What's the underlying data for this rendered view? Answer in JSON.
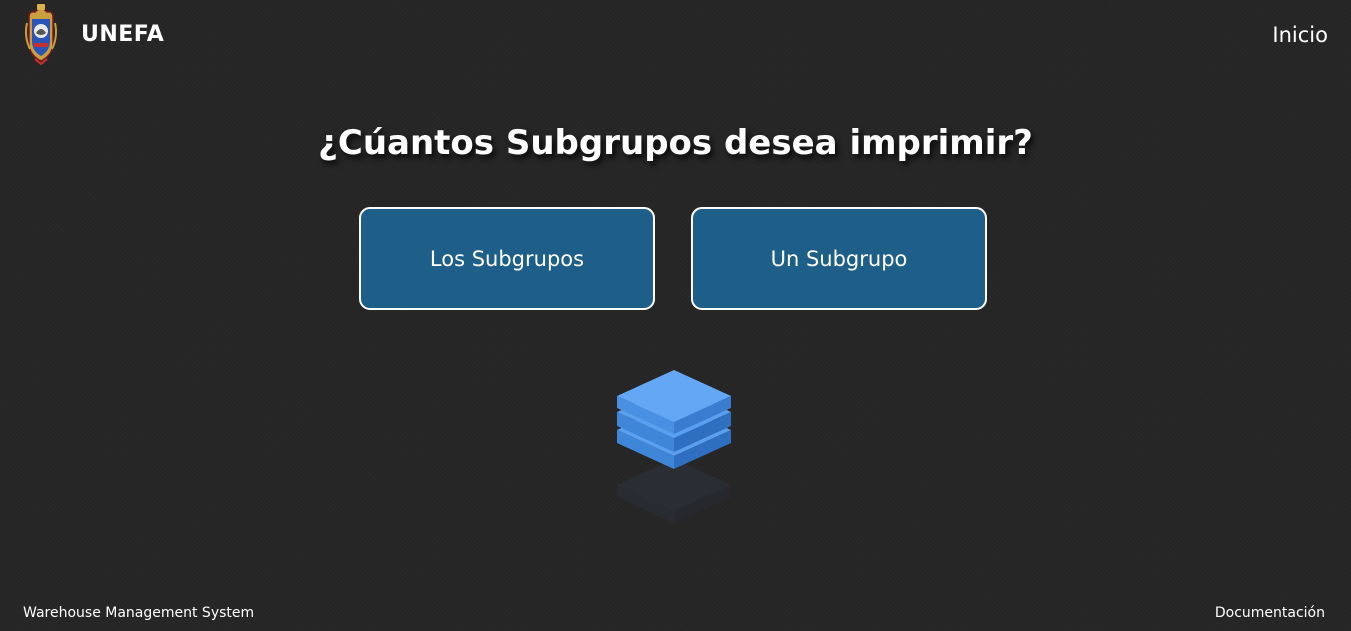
{
  "header": {
    "brand": "UNEFA",
    "nav_inicio": "Inicio",
    "logo_icon": "unefa-crest-logo"
  },
  "main": {
    "question": "¿Cúantos Subgrupos desea imprimir?",
    "options": [
      {
        "label": "Los Subgrupos"
      },
      {
        "label": "Un Subgrupo"
      }
    ],
    "illustration_icon": "stacked-layers-icon"
  },
  "footer": {
    "left_text": "Warehouse Management System",
    "right_link": "Documentación"
  },
  "colors": {
    "background": "#262626",
    "button_fill": "#1e5f8a",
    "button_border": "#ffffff",
    "text": "#ffffff",
    "stack_blue": "#4a90e2"
  }
}
